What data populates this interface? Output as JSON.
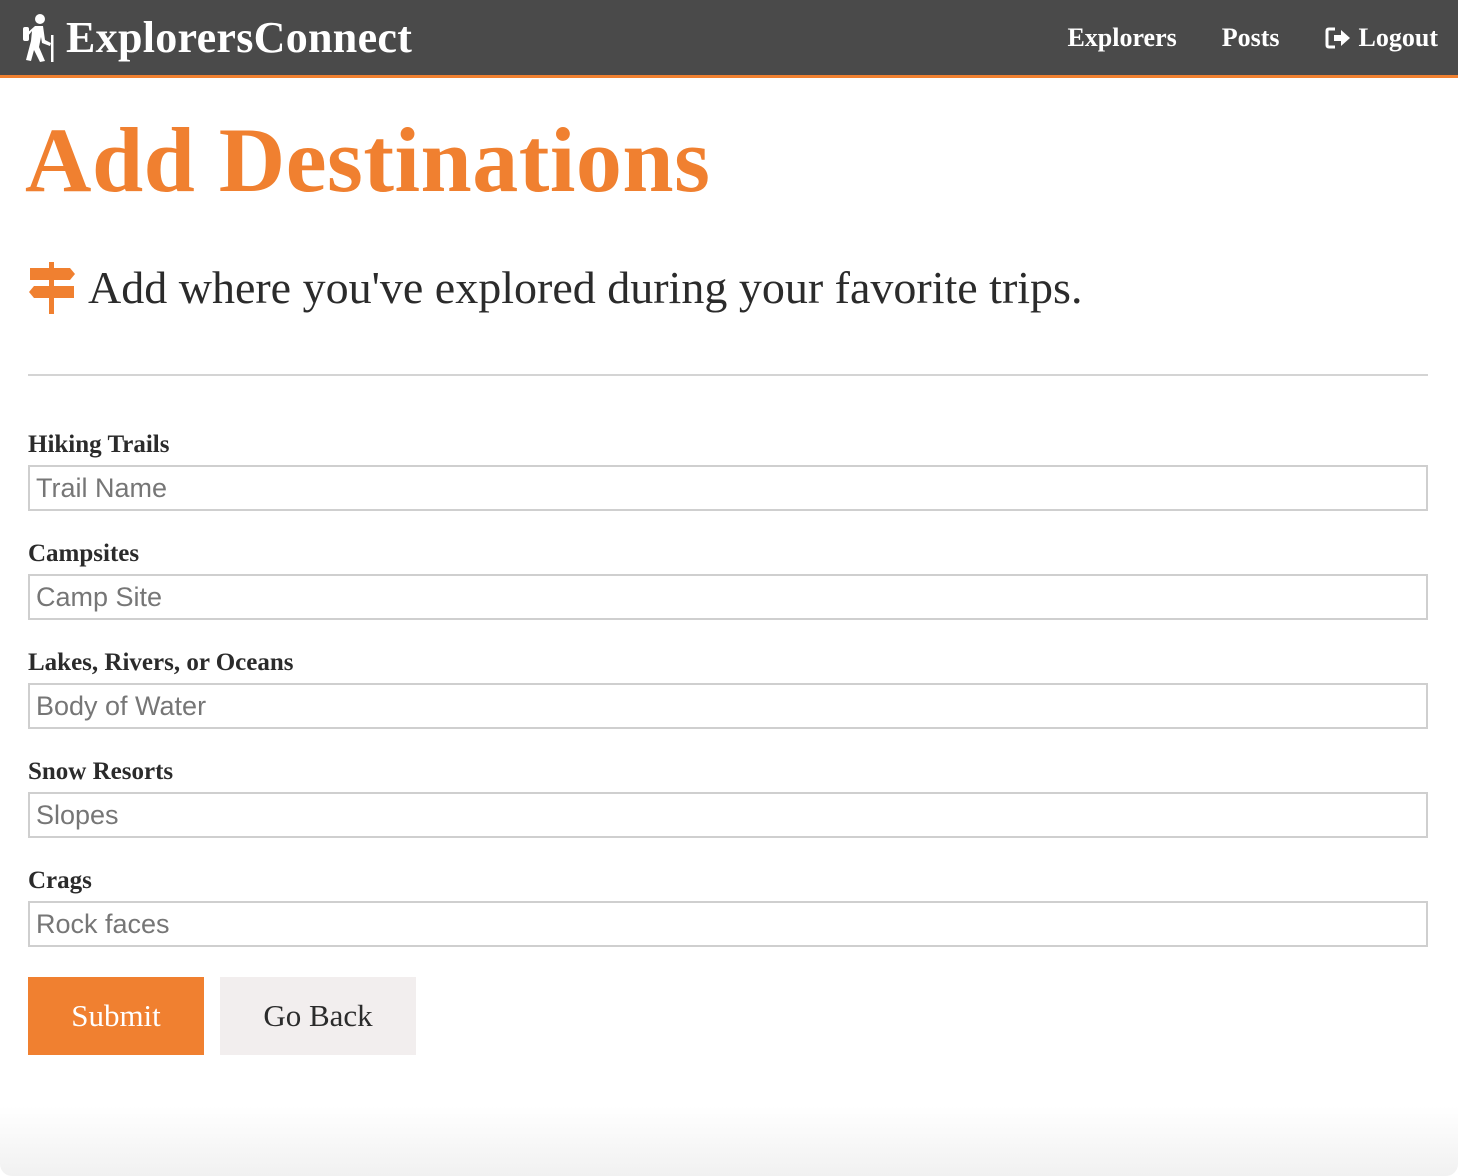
{
  "navbar": {
    "brand_icon": "hiker-icon",
    "brand_name": "ExplorersConnect",
    "links": [
      {
        "label": "Explorers"
      },
      {
        "label": "Posts"
      },
      {
        "label": "Logout",
        "icon": "logout-icon"
      }
    ],
    "background": "#4a4a4a",
    "accent": "#f08030"
  },
  "page": {
    "title": "Add Destinations",
    "subtitle_icon": "signpost-icon",
    "subtitle": "Add where you've explored during your favorite trips."
  },
  "form": {
    "fields": [
      {
        "label": "Hiking Trails",
        "placeholder": "Trail Name",
        "value": ""
      },
      {
        "label": "Campsites",
        "placeholder": "Camp Site",
        "value": ""
      },
      {
        "label": "Lakes, Rivers, or Oceans",
        "placeholder": "Body of Water",
        "value": ""
      },
      {
        "label": "Snow Resorts",
        "placeholder": "Slopes",
        "value": ""
      },
      {
        "label": "Crags",
        "placeholder": "Rock faces",
        "value": ""
      }
    ],
    "submit_label": "Submit",
    "back_label": "Go Back"
  }
}
